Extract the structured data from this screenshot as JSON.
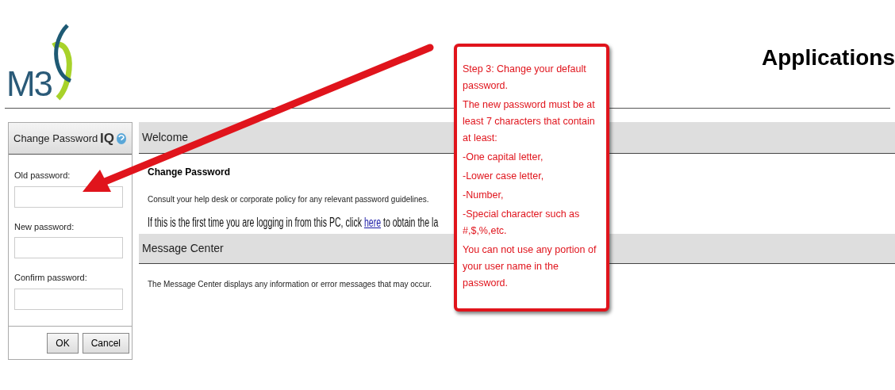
{
  "header": {
    "logo_text": "M3",
    "title": "Applications"
  },
  "panel": {
    "title": "Change Password",
    "badge": "IQ",
    "fields": [
      {
        "label": "Old password:"
      },
      {
        "label": "New password:"
      },
      {
        "label": "Confirm password:"
      }
    ],
    "buttons": [
      "OK",
      "Cancel"
    ]
  },
  "sections": [
    {
      "title": "Welcome",
      "heading": "Change Password",
      "text": "Consult your help desk or corporate policy for any relevant password guidelines.",
      "note_before": "If this is the first time you are logging in from this PC, click",
      "link": "here",
      "note_after": "to obtain the la"
    },
    {
      "title": "Message Center",
      "text": "The Message Center displays any information or error messages that may occur."
    }
  ],
  "callout": {
    "lines": [
      "Step 3: Change your default password.",
      "The new password must be at least 7 characters that contain at least:",
      "-One capital letter,",
      "-Lower case letter,",
      "-Number,",
      "-Special character such as #,$,%,etc.",
      "You can not use any portion of your user name in the password."
    ]
  }
}
